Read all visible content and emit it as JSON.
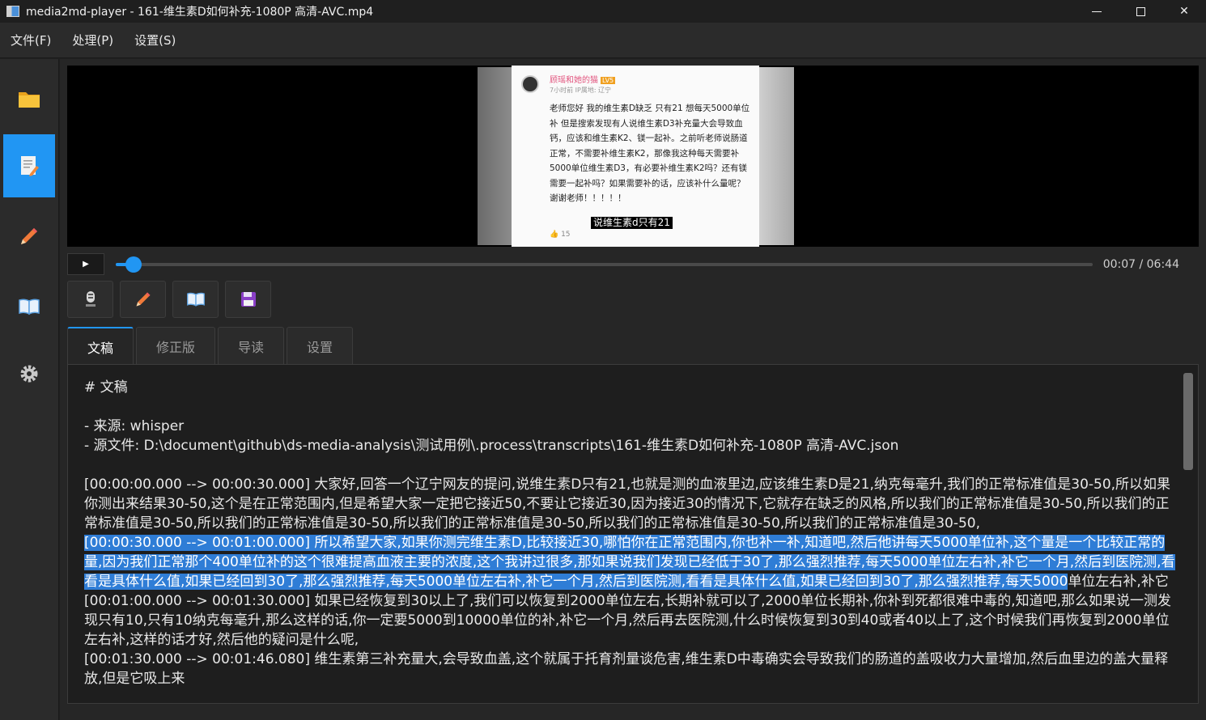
{
  "window": {
    "title": "media2md-player - 161-维生素D如何补充-1080P 高清-AVC.mp4",
    "minimize": "—",
    "close": "✕"
  },
  "menu": [
    {
      "label": "文件(F)"
    },
    {
      "label": "处理(P)"
    },
    {
      "label": "设置(S)"
    }
  ],
  "sidebar": {
    "items": [
      {
        "icon": "folder-icon"
      },
      {
        "icon": "document-edit-icon",
        "active": true
      },
      {
        "icon": "pencil-icon"
      },
      {
        "icon": "book-icon"
      },
      {
        "icon": "gear-icon"
      }
    ]
  },
  "video": {
    "post_user": "顾瑶和她的猫",
    "post_level": "LV5",
    "post_meta": "7小时前 IP属地: 辽宁",
    "post_body": "老师您好 我的维生素D缺乏 只有21 想每天5000单位补 但是搜索发现有人说维生素D3补充量大会导致血钙，应该和维生素K2、镁一起补。之前听老师说肠道正常，不需要补维生素K2，那像我这种每天需要补5000单位维生素D3，有必要补维生素K2吗？还有镁需要一起补吗？如果需要补的话，应该补什么量呢？谢谢老师！！！！！",
    "subtitle": "说维生素d只有21",
    "post_likes": "15"
  },
  "player": {
    "play_label": "▶",
    "progress": 0.018,
    "time": "00:07 / 06:44"
  },
  "toolbar": [
    {
      "icon": "microphone-icon"
    },
    {
      "icon": "pencil-icon"
    },
    {
      "icon": "book-icon"
    },
    {
      "icon": "save-icon"
    }
  ],
  "tabs": [
    {
      "label": "文稿",
      "active": true
    },
    {
      "label": "修正版"
    },
    {
      "label": "导读"
    },
    {
      "label": "设置"
    }
  ],
  "editor": {
    "heading": "# 文稿",
    "source": "- 来源: whisper",
    "source_file": "- 源文件: D:\\document\\github\\ds-media-analysis\\测试用例\\.process\\transcripts\\161-维生素D如何补充-1080P 高清-AVC.json",
    "seg1": "[00:00:00.000 --> 00:00:30.000] 大家好,回答一个辽宁网友的提问,说维生素D只有21,也就是测的血液里边,应该维生素D是21,纳克每毫升,我们的正常标准值是30-50,所以如果你测出来结果30-50,这个是在正常范围内,但是希望大家一定把它接近50,不要让它接近30,因为接近30的情况下,它就存在缺乏的风格,所以我们的正常标准值是30-50,所以我们的正常标准值是30-50,所以我们的正常标准值是30-50,所以我们的正常标准值是30-50,所以我们的正常标准值是30-50,所以我们的正常标准值是30-50,",
    "seg2_selected": "[00:00:30.000 --> 00:01:00.000] 所以希望大家,如果你测完维生素D,比较接近30,哪怕你在正常范围内,你也补一补,知道吧,然后他讲每天5000单位补,这个量是一个比较正常的量,因为我们正常那个400单位补的这个很难提高血液主要的浓度,这个我讲过很多,那如果说我们发现已经低于30了,那么强烈推荐,每天5000单位左右补,补它一个月,然后到医院测,看看是具体什么值,如果已经回到30了,那么强烈推荐,每天5000单位左右补,补它一个月,然后到医院测,看看是具体什么值,如果已经回到30了,那么强烈推荐,每天5000",
    "seg2_rest": "单位左右补,补它",
    "seg3": "[00:01:00.000 --> 00:01:30.000] 如果已经恢复到30以上了,我们可以恢复到2000单位左右,长期补就可以了,2000单位长期补,你补到死都很难中毒的,知道吧,那么如果说一测发现只有10,只有10纳克每毫升,那么这样的话,你一定要5000到10000单位的补,补它一个月,然后再去医院测,什么时候恢复到30到40或者40以上了,这个时候我们再恢复到2000单位左右补,这样的话才好,然后他的疑问是什么呢,",
    "seg4": "[00:01:30.000 --> 00:01:46.080] 维生素第三补充量大,会导致血盖,这个就属于托育剂量谈危害,维生素D中毒确实会导致我们的肠道的盖吸收力大量增加,然后血里边的盖大量释放,但是它吸上来"
  }
}
